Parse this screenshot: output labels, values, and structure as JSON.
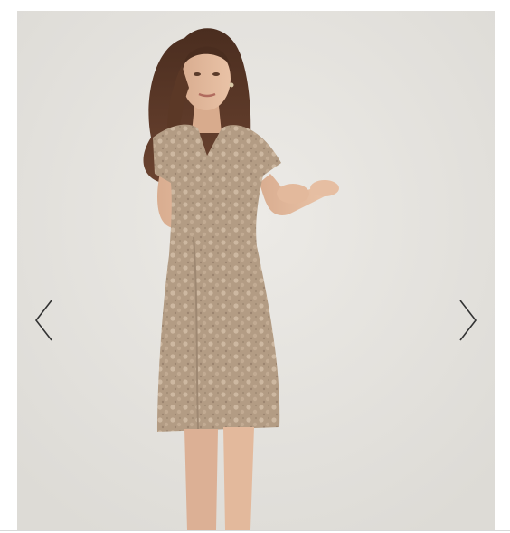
{
  "gallery": {
    "image": {
      "description_icon": "product-photo",
      "background_color": "#e6e5e1",
      "dress_color": "#b59f88"
    },
    "prev_icon": "chevron-left-icon",
    "next_icon": "chevron-right-icon",
    "arrow_color": "#333333"
  }
}
